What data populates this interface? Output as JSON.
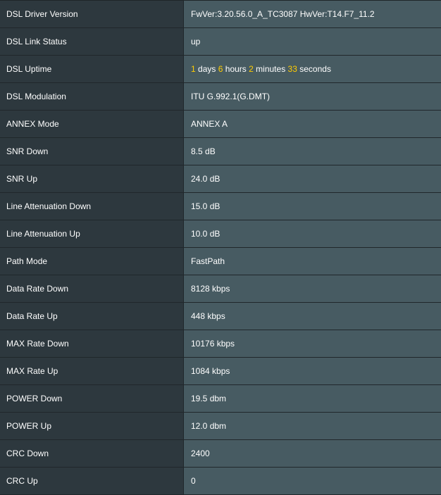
{
  "rows": [
    {
      "label": "DSL Driver Version",
      "value": "FwVer:3.20.56.0_A_TC3087 HwVer:T14.F7_11.2"
    },
    {
      "label": "DSL Link Status",
      "value": "up"
    },
    {
      "label": "DSL Uptime",
      "value": ""
    },
    {
      "label": "DSL Modulation",
      "value": "ITU G.992.1(G.DMT)"
    },
    {
      "label": "ANNEX Mode",
      "value": "ANNEX A"
    },
    {
      "label": "SNR Down",
      "value": "8.5 dB"
    },
    {
      "label": "SNR Up",
      "value": "24.0 dB"
    },
    {
      "label": "Line Attenuation Down",
      "value": "15.0 dB"
    },
    {
      "label": "Line Attenuation Up",
      "value": "10.0 dB"
    },
    {
      "label": "Path Mode",
      "value": "FastPath"
    },
    {
      "label": "Data Rate Down",
      "value": "8128 kbps"
    },
    {
      "label": "Data Rate Up",
      "value": "448 kbps"
    },
    {
      "label": "MAX Rate Down",
      "value": "10176 kbps"
    },
    {
      "label": "MAX Rate Up",
      "value": "1084 kbps"
    },
    {
      "label": "POWER Down",
      "value": "19.5 dbm"
    },
    {
      "label": "POWER Up",
      "value": "12.0 dbm"
    },
    {
      "label": "CRC Down",
      "value": "2400"
    },
    {
      "label": "CRC Up",
      "value": "0"
    }
  ],
  "uptime": {
    "days": "1",
    "days_unit": "days",
    "hours": "6",
    "hours_unit": "hours",
    "minutes": "2",
    "minutes_unit": "minutes",
    "seconds": "33",
    "seconds_unit": "seconds"
  },
  "colors": {
    "label_bg": "#2d383e",
    "value_bg": "#475b62",
    "border": "#20272b",
    "text": "#ffffff",
    "highlight": "#ffcc00"
  }
}
